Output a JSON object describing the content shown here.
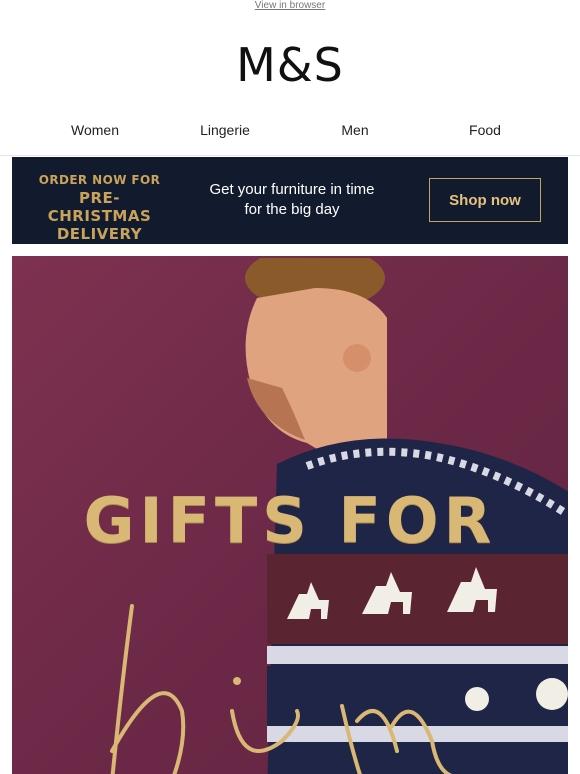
{
  "header": {
    "view_in_browser": "View in browser",
    "logo_text": "M&S"
  },
  "nav": {
    "items": [
      {
        "label": "Women"
      },
      {
        "label": "Lingerie"
      },
      {
        "label": "Men"
      },
      {
        "label": "Food"
      }
    ]
  },
  "banner": {
    "line1": "ORDER NOW FOR",
    "line2": "PRE-CHRISTMAS DELIVERY",
    "message": "Get your furniture in time for the big day",
    "button_label": "Shop now",
    "background_color": "#111b2d",
    "accent_color": "#c9a35a"
  },
  "hero": {
    "title": "GIFTS FOR",
    "script_text": "him",
    "background_color": "#7a2e4c",
    "title_color": "#d8b874"
  }
}
